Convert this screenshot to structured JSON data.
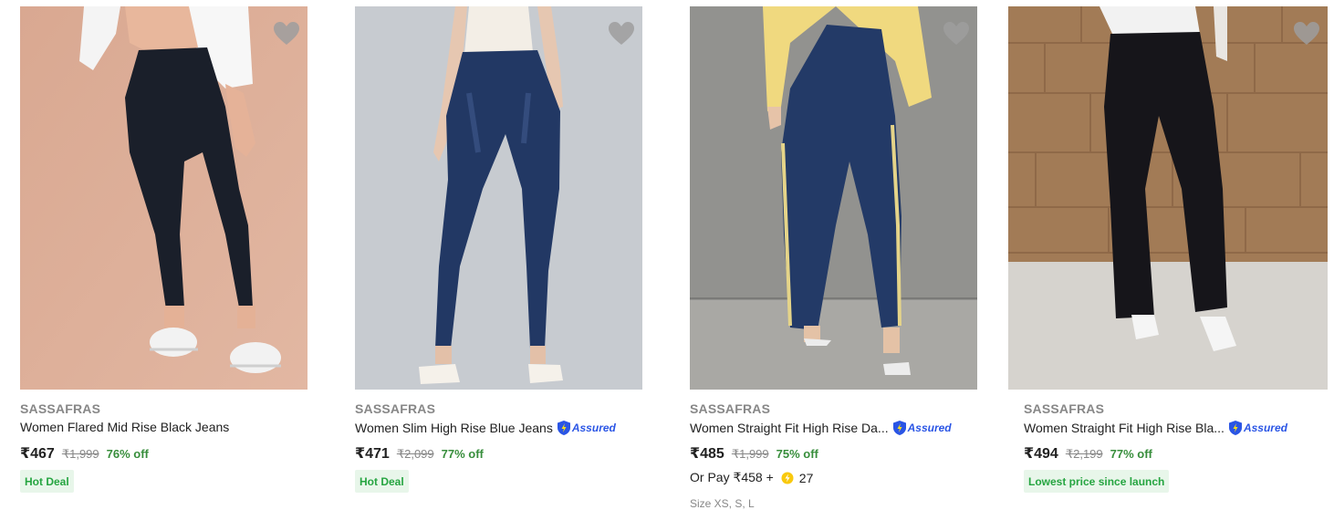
{
  "products": [
    {
      "brand": "SASSAFRAS",
      "title": "Women Flared Mid Rise Black Jeans",
      "assured": false,
      "price": "₹467",
      "mrp": "₹1,999",
      "discount": "76% off",
      "badge": "Hot Deal",
      "wishlist_icon": "heart-icon"
    },
    {
      "brand": "SASSAFRAS",
      "title": "Women Slim High Rise Blue Jeans",
      "assured": true,
      "assured_label": "Assured",
      "price": "₹471",
      "mrp": "₹2,099",
      "discount": "77% off",
      "badge": "Hot Deal",
      "wishlist_icon": "heart-icon"
    },
    {
      "brand": "SASSAFRAS",
      "title": "Women Straight Fit High Rise Da...",
      "assured": true,
      "assured_label": "Assured",
      "price": "₹485",
      "mrp": "₹1,999",
      "discount": "75% off",
      "or_pay": "Or Pay ₹458 +",
      "coins": "27",
      "size_text": "Size XS, S, L",
      "wishlist_icon": "heart-icon"
    },
    {
      "brand": "SASSAFRAS",
      "title": "Women Straight Fit High Rise Bla...",
      "assured": true,
      "assured_label": "Assured",
      "price": "₹494",
      "mrp": "₹2,199",
      "discount": "77% off",
      "badge": "Lowest price since launch",
      "wishlist_icon": "heart-icon"
    }
  ],
  "colors": {
    "brand_grey": "#878787",
    "discount_green": "#388e3c",
    "badge_bg": "#e8f6ea",
    "badge_text": "#26a541",
    "assured_blue": "#2a55e5",
    "wishlist_grey": "#9e9e9e"
  }
}
